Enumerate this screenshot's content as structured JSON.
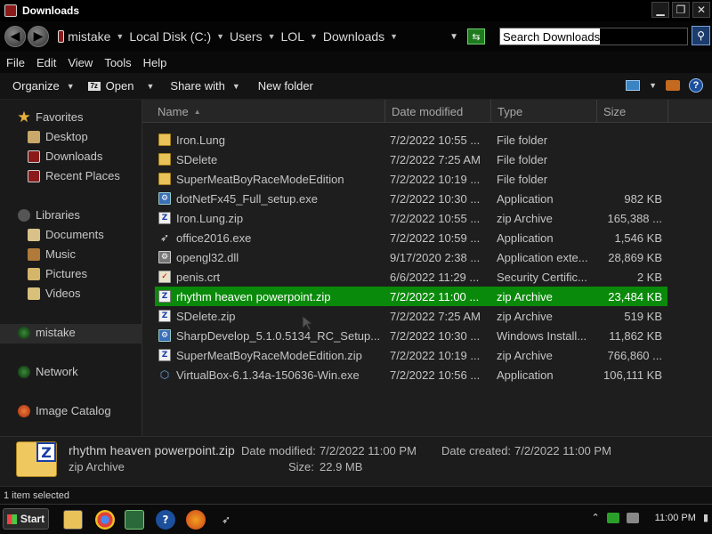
{
  "window": {
    "title": "Downloads",
    "buttons": {
      "minimize": "▁",
      "restore": "❐",
      "close": "✕"
    }
  },
  "address": {
    "crumbs": [
      "mistake",
      "Local Disk (C:)",
      "Users",
      "LOL",
      "Downloads"
    ],
    "search_placeholder": "Search Downloads"
  },
  "menu": [
    "File",
    "Edit",
    "View",
    "Tools",
    "Help"
  ],
  "toolbar": {
    "organize": "Organize",
    "open": "Open",
    "share_with": "Share with",
    "new_folder": "New folder"
  },
  "nav": {
    "favorites": "Favorites",
    "desktop": "Desktop",
    "downloads": "Downloads",
    "recent": "Recent Places",
    "libraries": "Libraries",
    "documents": "Documents",
    "music": "Music",
    "pictures": "Pictures",
    "videos": "Videos",
    "computer": "mistake",
    "network": "Network",
    "image_catalog": "Image Catalog"
  },
  "columns": {
    "name": "Name",
    "date": "Date modified",
    "type": "Type",
    "size": "Size"
  },
  "files": [
    {
      "name": "Iron.Lung",
      "date": "7/2/2022 10:55 ...",
      "type": "File folder",
      "size": "",
      "icon": "folder-icon"
    },
    {
      "name": "SDelete",
      "date": "7/2/2022 7:25 AM",
      "type": "File folder",
      "size": "",
      "icon": "folder-icon"
    },
    {
      "name": "SuperMeatBoyRaceModeEdition",
      "date": "7/2/2022 10:19 ...",
      "type": "File folder",
      "size": "",
      "icon": "folder-icon"
    },
    {
      "name": "dotNetFx45_Full_setup.exe",
      "date": "7/2/2022 10:30 ...",
      "type": "Application",
      "size": "982 KB",
      "icon": "exe-icon"
    },
    {
      "name": "Iron.Lung.zip",
      "date": "7/2/2022 10:55 ...",
      "type": "zip Archive",
      "size": "165,388 ...",
      "icon": "zip-icon"
    },
    {
      "name": "office2016.exe",
      "date": "7/2/2022 10:59 ...",
      "type": "Application",
      "size": "1,546 KB",
      "icon": "rocket-icon"
    },
    {
      "name": "opengl32.dll",
      "date": "9/17/2020 2:38 ...",
      "type": "Application exte...",
      "size": "28,869 KB",
      "icon": "dll-icon"
    },
    {
      "name": "penis.crt",
      "date": "6/6/2022 11:29 ...",
      "type": "Security Certific...",
      "size": "2 KB",
      "icon": "certificate-icon"
    },
    {
      "name": "rhythm heaven powerpoint.zip",
      "date": "7/2/2022 11:00 ...",
      "type": "zip Archive",
      "size": "23,484 KB",
      "icon": "zip-icon",
      "selected": true
    },
    {
      "name": "SDelete.zip",
      "date": "7/2/2022 7:25 AM",
      "type": "zip Archive",
      "size": "519 KB",
      "icon": "zip-icon"
    },
    {
      "name": "SharpDevelop_5.1.0.5134_RC_Setup...",
      "date": "7/2/2022 10:30 ...",
      "type": "Windows Install...",
      "size": "11,862 KB",
      "icon": "installer-icon"
    },
    {
      "name": "SuperMeatBoyRaceModeEdition.zip",
      "date": "7/2/2022 10:19 ...",
      "type": "zip Archive",
      "size": "766,860 ...",
      "icon": "zip-icon"
    },
    {
      "name": "VirtualBox-6.1.34a-150636-Win.exe",
      "date": "7/2/2022 10:56 ...",
      "type": "Application",
      "size": "106,111 KB",
      "icon": "virtualbox-icon"
    }
  ],
  "details": {
    "filename": "rhythm heaven powerpoint.zip",
    "filetype": "zip Archive",
    "modified_label": "Date modified:",
    "modified_value": "7/2/2022 11:00 PM",
    "created_label": "Date created:",
    "created_value": "7/2/2022 11:00 PM",
    "size_label": "Size:",
    "size_value": "22.9 MB"
  },
  "status": "1 item selected",
  "taskbar": {
    "start": "Start",
    "clock": "11:00 PM"
  },
  "colors": {
    "selection": "#0a8a0a",
    "background": "#1e1e1e"
  }
}
